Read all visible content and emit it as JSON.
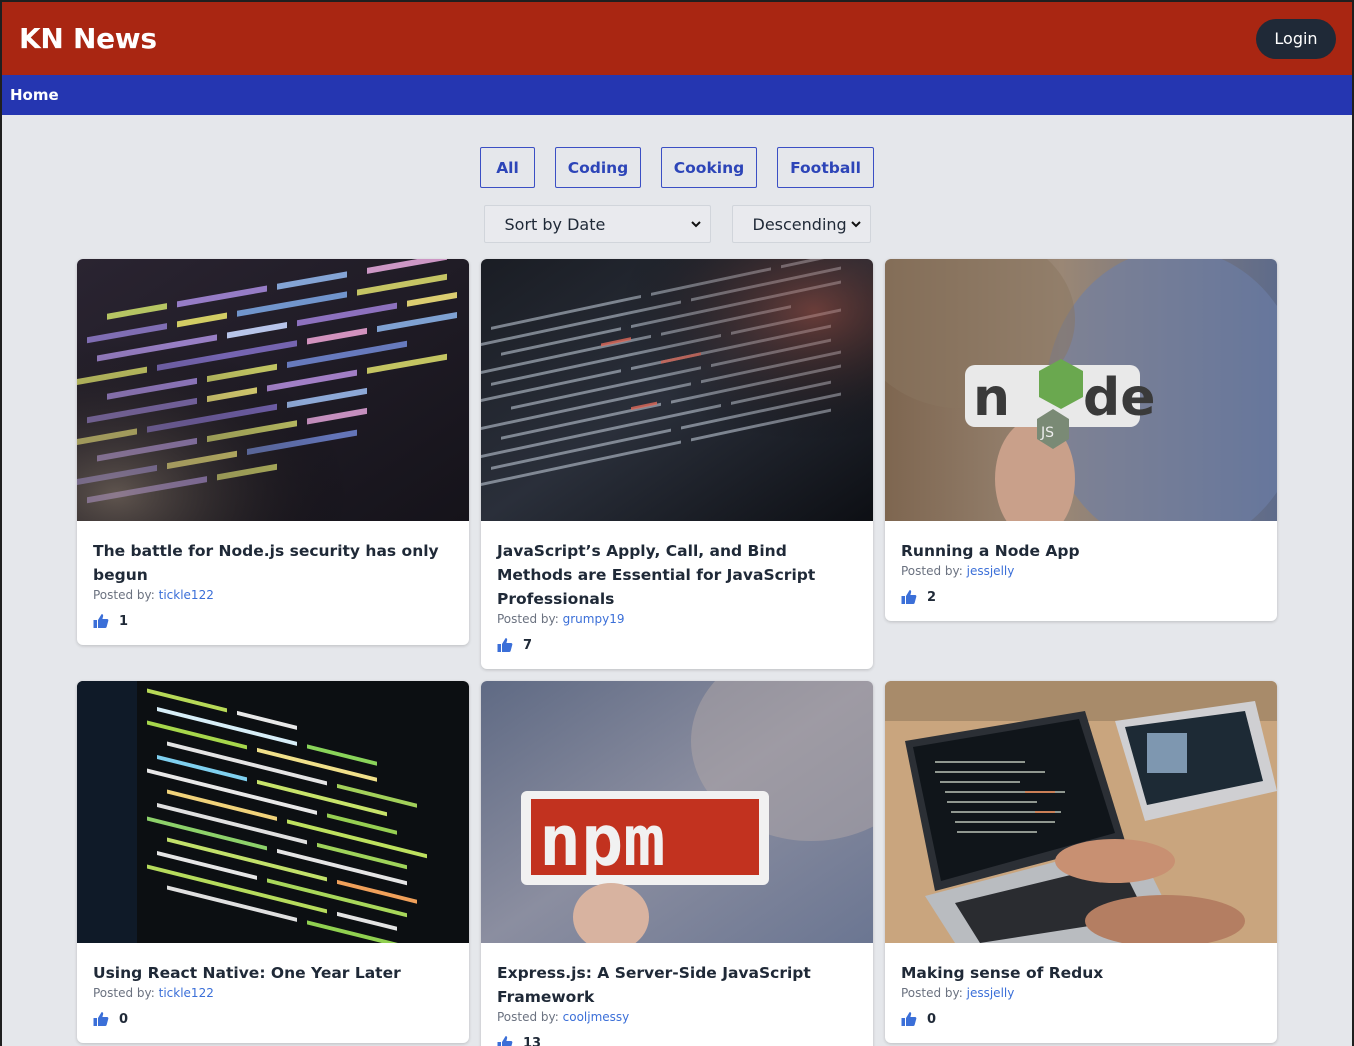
{
  "header": {
    "brand": "KN News",
    "login_label": "Login"
  },
  "nav": {
    "home_label": "Home"
  },
  "filters": [
    {
      "label": "All"
    },
    {
      "label": "Coding"
    },
    {
      "label": "Cooking"
    },
    {
      "label": "Football"
    }
  ],
  "sort": {
    "by": "Sort by Date",
    "order": "Descending"
  },
  "posted_prefix": "Posted by: ",
  "articles": [
    {
      "title": "The battle for Node.js security has only begun",
      "author": "tickle122",
      "votes": "1",
      "image": "code-colorful-screen"
    },
    {
      "title": "JavaScript’s Apply, Call, and Bind Methods are Essential for JavaScript Professionals",
      "author": "grumpy19",
      "votes": "7",
      "image": "code-dark-screen"
    },
    {
      "title": "Running a Node App",
      "author": "jessjelly",
      "votes": "2",
      "image": "nodejs-sticker"
    },
    {
      "title": "Using React Native: One Year Later",
      "author": "tickle122",
      "votes": "0",
      "image": "code-green-screen"
    },
    {
      "title": "Express.js: A Server-Side JavaScript Framework",
      "author": "cooljmessy",
      "votes": "13",
      "image": "npm-sticker"
    },
    {
      "title": "Making sense of Redux",
      "author": "jessjelly",
      "votes": "0",
      "image": "laptops-desk"
    }
  ],
  "colors": {
    "header": "#a92612",
    "nav": "#2536b1",
    "accent": "#2d45b8",
    "background": "#e5e7eb"
  }
}
